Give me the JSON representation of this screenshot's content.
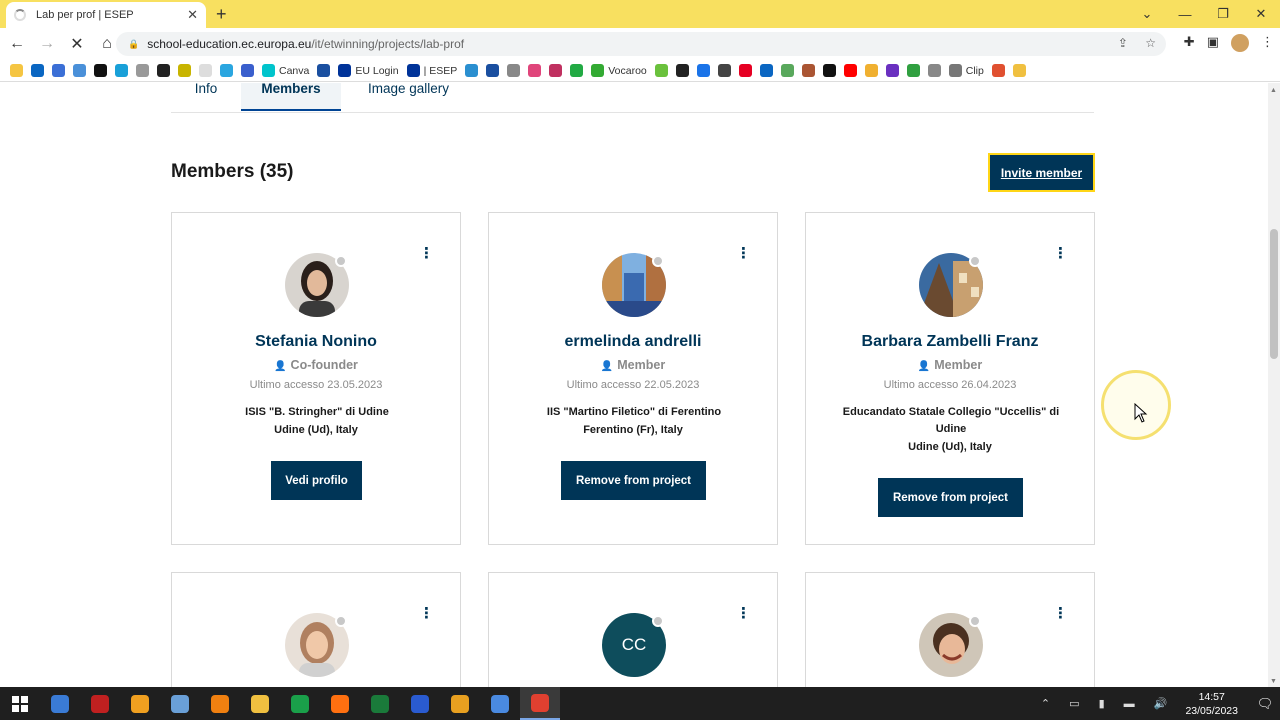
{
  "browser": {
    "tab_title": "Lab per prof | ESEP",
    "url_host": "school-education.ec.europa.eu",
    "url_path": "/it/etwinning/projects/lab-prof",
    "bookmarks": [
      {
        "label": "",
        "color": "#f5c542"
      },
      {
        "label": "",
        "color": "#0a66c2"
      },
      {
        "label": "",
        "color": "#3b6fd6"
      },
      {
        "label": "",
        "color": "#4a90d9"
      },
      {
        "label": "",
        "color": "#111111"
      },
      {
        "label": "",
        "color": "#19a0d8"
      },
      {
        "label": "",
        "color": "#999999"
      },
      {
        "label": "",
        "color": "#222222"
      },
      {
        "label": "",
        "color": "#c8b400"
      },
      {
        "label": "",
        "color": "#dddddd"
      },
      {
        "label": "",
        "color": "#2aa6e0"
      },
      {
        "label": "",
        "color": "#3a5fcd"
      },
      {
        "label": "Canva",
        "color": "#00c4cc"
      },
      {
        "label": "",
        "color": "#1a4fa0"
      },
      {
        "label": "EU Login",
        "color": "#003399"
      },
      {
        "label": "| ESEP",
        "color": "#003399"
      },
      {
        "label": "",
        "color": "#2a8fd0"
      },
      {
        "label": "",
        "color": "#1a4fa0"
      },
      {
        "label": "",
        "color": "#888888"
      },
      {
        "label": "",
        "color": "#e0457b"
      },
      {
        "label": "",
        "color": "#c03060"
      },
      {
        "label": "",
        "color": "#22aa44"
      },
      {
        "label": "Vocaroo",
        "color": "#33aa33"
      },
      {
        "label": "",
        "color": "#6ac13c"
      },
      {
        "label": "",
        "color": "#222222"
      },
      {
        "label": "",
        "color": "#1a73e8"
      },
      {
        "label": "",
        "color": "#444444"
      },
      {
        "label": "",
        "color": "#e60023"
      },
      {
        "label": "",
        "color": "#0a66c2"
      },
      {
        "label": "",
        "color": "#59a85c"
      },
      {
        "label": "",
        "color": "#aa5533"
      },
      {
        "label": "",
        "color": "#111111"
      },
      {
        "label": "",
        "color": "#ff0000"
      },
      {
        "label": "",
        "color": "#f0b030"
      },
      {
        "label": "",
        "color": "#6a30c0"
      },
      {
        "label": "",
        "color": "#30a040"
      },
      {
        "label": "",
        "color": "#888888"
      },
      {
        "label": "Clip",
        "color": "#777777"
      },
      {
        "label": "",
        "color": "#e05030"
      },
      {
        "label": "",
        "color": "#f0c040"
      }
    ]
  },
  "page": {
    "tabs": [
      {
        "label": "Info"
      },
      {
        "label": "Members"
      },
      {
        "label": "Image gallery"
      }
    ],
    "members_title": "Members (35)",
    "invite_label": "Invite member",
    "cards": [
      {
        "name": "Stefania Nonino",
        "role": "Co-founder",
        "last_access": "Ultimo accesso 23.05.2023",
        "school": "ISIS \"B. Stringher\" di Udine",
        "location": "Udine (Ud), Italy",
        "action": "Vedi profilo"
      },
      {
        "name": "ermelinda andrelli",
        "role": "Member",
        "last_access": "Ultimo accesso 22.05.2023",
        "school": "IIS \"Martino Filetico\" di Ferentino",
        "location": "Ferentino (Fr), Italy",
        "action": "Remove from project"
      },
      {
        "name": "Barbara Zambelli Franz",
        "role": "Member",
        "last_access": "Ultimo accesso 26.04.2023",
        "school": "Educandato Statale Collegio \"Uccellis\" di Udine",
        "location": "Udine (Ud), Italy",
        "action": "Remove from project"
      }
    ],
    "second_row_initials": "CC"
  },
  "taskbar": {
    "time": "14:57",
    "date": "23/05/2023",
    "apps": [
      "#3a7bd5",
      "#c02020",
      "#f0a020",
      "#6aa0d8",
      "#f08010",
      "#f0c040",
      "#1aa04a",
      "#ff7010",
      "#1a7a3a",
      "#2a5bd0",
      "#e8a020",
      "#4a8ae0",
      "#e04030"
    ]
  },
  "colors": {
    "primary": "#003557",
    "accent_yellow": "#ffd617",
    "chrome_tabstrip": "#f8e060"
  }
}
